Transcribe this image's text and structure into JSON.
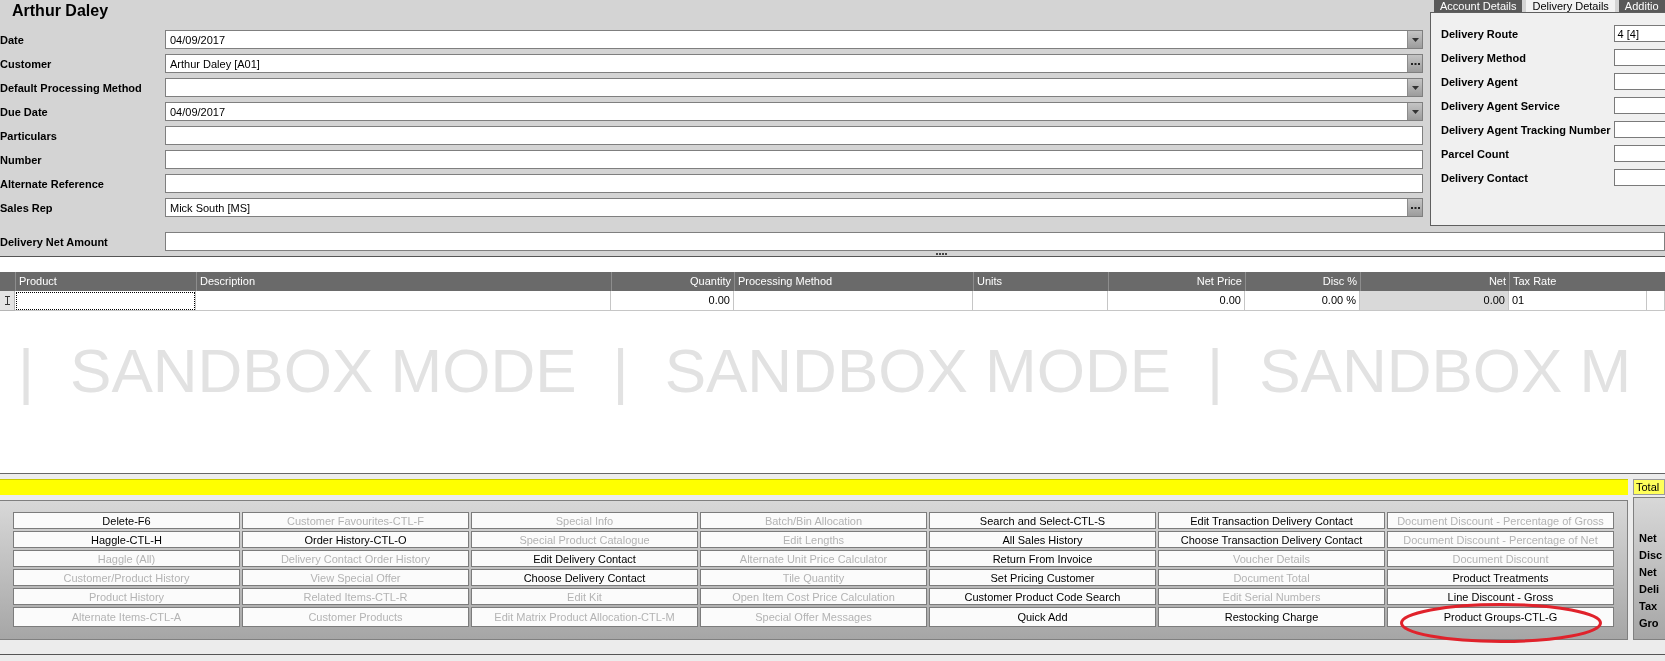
{
  "header": {
    "title": "Arthur Daley"
  },
  "form": {
    "fields": [
      {
        "label": "Date",
        "value": "04/09/2017",
        "kind": "dropdown"
      },
      {
        "label": "Customer",
        "value": "Arthur Daley [A01]",
        "kind": "lookup"
      },
      {
        "label": "Default Processing Method",
        "kind": "dropdown"
      },
      {
        "label": "Due Date",
        "value": "04/09/2017",
        "kind": "dropdown"
      },
      {
        "label": "Particulars",
        "kind": "text"
      },
      {
        "label": "Number",
        "kind": "text"
      },
      {
        "label": "Alternate Reference",
        "kind": "text"
      },
      {
        "label": "Sales Rep",
        "value": "Mick South [MS]",
        "kind": "lookup"
      }
    ],
    "delivery_net_amount": {
      "label": "Delivery Net Amount"
    }
  },
  "details_panel": {
    "tabs": [
      {
        "label": "Account Details",
        "selected": false
      },
      {
        "label": "Delivery Details",
        "selected": true
      },
      {
        "label": "Additio",
        "selected": false
      }
    ],
    "fields": [
      {
        "label": "Delivery Route",
        "value": "4 [4]"
      },
      {
        "label": "Delivery Method"
      },
      {
        "label": "Delivery Agent"
      },
      {
        "label": "Delivery Agent Service"
      },
      {
        "label": "Delivery Agent Tracking Number"
      },
      {
        "label": "Parcel Count"
      },
      {
        "label": "Delivery Contact"
      }
    ]
  },
  "lines_grid": {
    "columns": [
      {
        "label": "Product",
        "kind": "text",
        "read_only": false
      },
      {
        "label": "Description",
        "kind": "text",
        "read_only": false
      },
      {
        "label": "Quantity",
        "kind": "number",
        "read_only": false
      },
      {
        "label": "Processing Method",
        "kind": "text",
        "read_only": false
      },
      {
        "label": "Units",
        "kind": "text",
        "read_only": false
      },
      {
        "label": "Net Price",
        "kind": "number",
        "read_only": false
      },
      {
        "label": "Disc %",
        "kind": "number",
        "read_only": false
      },
      {
        "label": "Net",
        "kind": "number",
        "read_only": true
      },
      {
        "label": "Tax Rate",
        "kind": "text",
        "read_only": false
      }
    ],
    "rows": [
      {
        "current": true,
        "cells": [
          {
            "focused": true
          },
          {
            "focused": false
          },
          {
            "text": "0.00",
            "focused": false
          },
          {
            "focused": false
          },
          {
            "focused": false
          },
          {
            "text": "0.00",
            "focused": false
          },
          {
            "text": "0.00 %",
            "focused": false
          },
          {
            "text": "0.00",
            "focused": false
          },
          {
            "text": "01",
            "focused": false
          }
        ]
      }
    ]
  },
  "watermark": {
    "segments": [
      "|",
      "SANDBOX MODE",
      "|",
      "SANDBOX MODE",
      "|",
      "SANDBOX M"
    ]
  },
  "actions": {
    "buttons": [
      {
        "label": "Delete-F6",
        "disabled": false,
        "circled": false
      },
      {
        "label": "Customer Favourites-CTL-F",
        "disabled": true,
        "circled": false
      },
      {
        "label": "Special Info",
        "disabled": true,
        "circled": false
      },
      {
        "label": "Batch/Bin Allocation",
        "disabled": true,
        "circled": false
      },
      {
        "label": "Search and Select-CTL-S",
        "disabled": false,
        "circled": false
      },
      {
        "label": "Edit Transaction Delivery Contact",
        "disabled": false,
        "circled": false
      },
      {
        "label": "Document Discount - Percentage of Gross",
        "disabled": true,
        "circled": false
      },
      {
        "label": "Haggle-CTL-H",
        "disabled": false,
        "circled": false
      },
      {
        "label": "Order History-CTL-O",
        "disabled": false,
        "circled": false
      },
      {
        "label": "Special Product Catalogue",
        "disabled": true,
        "circled": false
      },
      {
        "label": "Edit Lengths",
        "disabled": true,
        "circled": false
      },
      {
        "label": "All Sales History",
        "disabled": false,
        "circled": false
      },
      {
        "label": "Choose Transaction Delivery Contact",
        "disabled": false,
        "circled": false
      },
      {
        "label": "Document Discount - Percentage of Net",
        "disabled": true,
        "circled": false
      },
      {
        "label": "Haggle (All)",
        "disabled": true,
        "circled": false
      },
      {
        "label": "Delivery Contact Order History",
        "disabled": true,
        "circled": false
      },
      {
        "label": "Edit Delivery Contact",
        "disabled": false,
        "circled": false
      },
      {
        "label": "Alternate Unit Price Calculator",
        "disabled": true,
        "circled": false
      },
      {
        "label": "Return From Invoice",
        "disabled": false,
        "circled": false
      },
      {
        "label": "Voucher Details",
        "disabled": true,
        "circled": false
      },
      {
        "label": "Document Discount",
        "disabled": true,
        "circled": false
      },
      {
        "label": "Customer/Product History",
        "disabled": true,
        "circled": false
      },
      {
        "label": "View Special Offer",
        "disabled": true,
        "circled": false
      },
      {
        "label": "Choose Delivery Contact",
        "disabled": false,
        "circled": false
      },
      {
        "label": "Tile Quantity",
        "disabled": true,
        "circled": false
      },
      {
        "label": "Set Pricing Customer",
        "disabled": false,
        "circled": false
      },
      {
        "label": "Document Total",
        "disabled": true,
        "circled": false
      },
      {
        "label": "Product Treatments",
        "disabled": false,
        "circled": false
      },
      {
        "label": "Product History",
        "disabled": true,
        "circled": false
      },
      {
        "label": "Related Items-CTL-R",
        "disabled": true,
        "circled": false
      },
      {
        "label": "Edit Kit",
        "disabled": true,
        "circled": false
      },
      {
        "label": "Open Item Cost Price Calculation",
        "disabled": true,
        "circled": false
      },
      {
        "label": "Customer Product Code Search",
        "disabled": false,
        "circled": false
      },
      {
        "label": "Edit Serial Numbers",
        "disabled": true,
        "circled": false
      },
      {
        "label": "Line Discount - Gross",
        "disabled": false,
        "circled": false
      },
      {
        "label": "Alternate Items-CTL-A",
        "disabled": true,
        "circled": false
      },
      {
        "label": "Customer Products",
        "disabled": true,
        "circled": false
      },
      {
        "label": "Edit Matrix Product Allocation-CTL-M",
        "disabled": true,
        "circled": false
      },
      {
        "label": "Special Offer Messages",
        "disabled": true,
        "circled": false
      },
      {
        "label": "Quick Add",
        "disabled": false,
        "circled": false
      },
      {
        "label": "Restocking Charge",
        "disabled": false,
        "circled": false
      },
      {
        "label": "Product Groups-CTL-G",
        "disabled": false,
        "circled": true
      }
    ]
  },
  "totals": {
    "title": "Total",
    "labels": [
      "Net",
      "Disc",
      "Net",
      "Deli",
      "Tax",
      "Gro"
    ]
  }
}
